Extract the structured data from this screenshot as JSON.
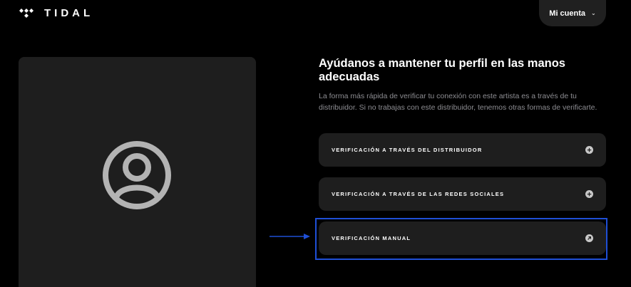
{
  "brand": {
    "name": "TIDAL",
    "logo_icon": "tidal-diamond-icon"
  },
  "header": {
    "account_label": "Mi cuenta",
    "account_chevron_icon": "chevron-down-icon"
  },
  "avatar": {
    "icon": "user-circle-icon",
    "color": "#b3b3b3"
  },
  "main": {
    "heading": "Ayúdanos a mantener tu perfil en las manos adecuadas",
    "description": "La forma más rápida de verificar tu conexión con este artista es a través de tu distribuidor. Si no trabajas con este distribuidor, tenemos otras formas de verificarte."
  },
  "options": [
    {
      "label": "VERIFICACIÓN A TRAVÉS DEL DISTRIBUIDOR",
      "icon": "plus-circle-icon"
    },
    {
      "label": "VERIFICACIÓN A TRAVÉS DE LAS REDES SOCIALES",
      "icon": "plus-circle-icon"
    },
    {
      "label": "VERIFICACIÓN MANUAL",
      "icon": "arrow-up-right-circle-icon"
    }
  ],
  "annotation": {
    "highlight_color": "#1f4fd6",
    "highlighted_option": "VERIFICACIÓN MANUAL"
  }
}
